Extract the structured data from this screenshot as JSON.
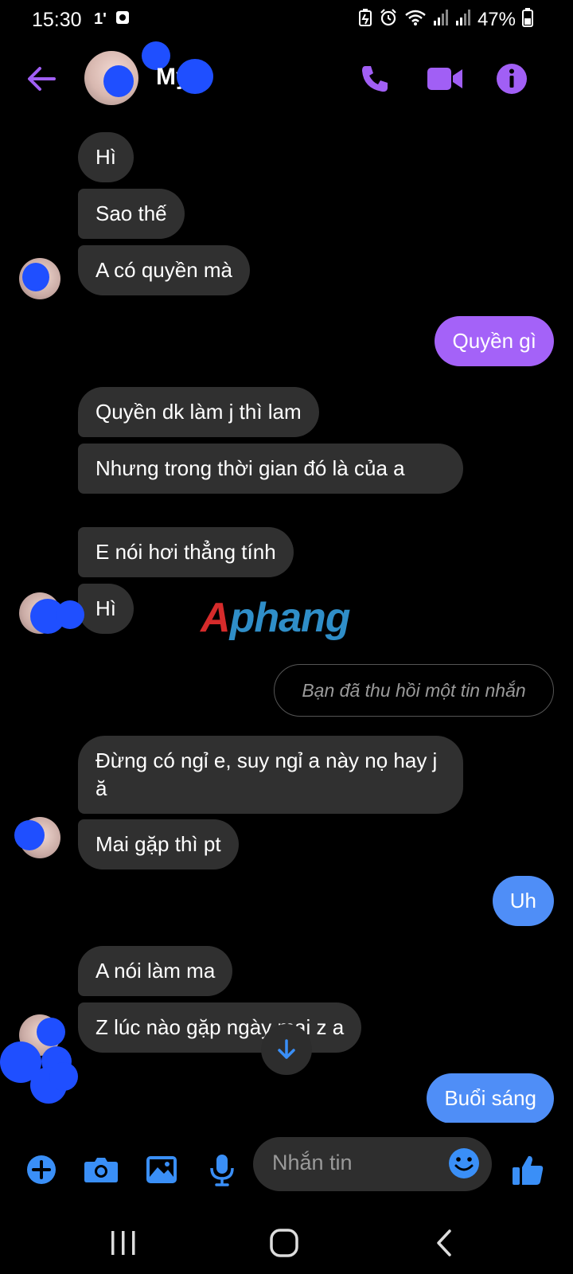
{
  "status_bar": {
    "time": "15:30",
    "left_icons": [
      "temperature-icon",
      "screenshot-icon"
    ],
    "temperature": "1'",
    "right_icons": [
      "battery-saver-icon",
      "alarm-icon",
      "wifi-icon",
      "signal-icon",
      "signal-icon"
    ],
    "battery": "47%"
  },
  "header": {
    "contact_name": "My",
    "actions": [
      "phone-icon",
      "video-icon",
      "info-icon"
    ],
    "accent_color": "#a15ff5"
  },
  "messages": [
    {
      "side": "in",
      "text": "Hì"
    },
    {
      "side": "in",
      "text": "Sao thế"
    },
    {
      "side": "in",
      "text": "A có quyền mà"
    },
    {
      "side": "out",
      "text": "Quyền gì"
    },
    {
      "side": "in",
      "text": "Quyền dk làm j thì lam"
    },
    {
      "side": "in",
      "text": "Nhưng trong thời gian đó là của a"
    },
    {
      "side": "in",
      "text": "E nói hơi thẳng tính"
    },
    {
      "side": "in",
      "text": "Hì"
    },
    {
      "side": "system",
      "text": "Bạn đã thu hồi một tin nhắn"
    },
    {
      "side": "in",
      "text": "Đừng có ngỉ e,  suy ngỉ a này nọ hay j ă"
    },
    {
      "side": "in",
      "text": "Mai gặp thì pt"
    },
    {
      "side": "out",
      "text": "Uh"
    },
    {
      "side": "in",
      "text": "A nói làm ma"
    },
    {
      "side": "in",
      "text": "Z lúc nào gặp ngày mai z a"
    },
    {
      "side": "out",
      "text": "Buổi sáng"
    }
  ],
  "watermark": {
    "first": "A",
    "rest": "phang"
  },
  "composer": {
    "placeholder": "Nhắn tin",
    "icons": [
      "plus-icon",
      "camera-icon",
      "gallery-icon",
      "microphone-icon",
      "emoji-icon",
      "thumbs-up-icon"
    ],
    "icon_color": "#3a8ff7"
  },
  "nav": [
    "recent-apps-icon",
    "home-icon",
    "back-icon"
  ]
}
